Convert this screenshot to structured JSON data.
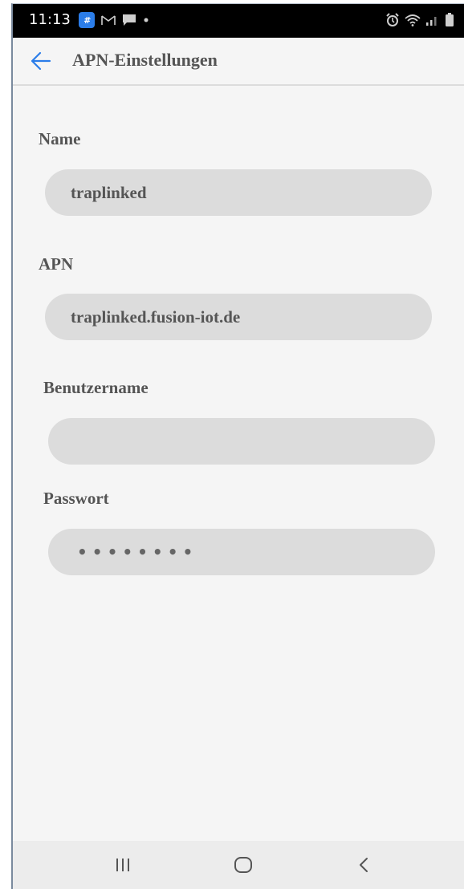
{
  "status_bar": {
    "time": "11:13",
    "app_badge": "#",
    "icons_left": [
      "app-badge-icon",
      "gmail-icon",
      "message-icon",
      "dot-icon"
    ],
    "icons_right": [
      "alarm-icon",
      "wifi-icon",
      "signal-icon",
      "battery-icon"
    ]
  },
  "header": {
    "title": "APN-Einstellungen",
    "back_icon": "arrow-left-icon"
  },
  "fields": {
    "name": {
      "label": "Name",
      "value": "traplinked"
    },
    "apn": {
      "label": "APN",
      "value": "traplinked.fusion-iot.de"
    },
    "username": {
      "label": "Benutzername",
      "value": ""
    },
    "password": {
      "label": "Passwort",
      "value": "••••••••"
    }
  },
  "nav_bar": {
    "buttons": [
      "recent-apps-icon",
      "home-icon",
      "back-icon"
    ]
  },
  "colors": {
    "accent": "#2b7de9",
    "input_background": "#dcdcdc",
    "text": "#555555",
    "page_background": "#f5f5f5"
  }
}
